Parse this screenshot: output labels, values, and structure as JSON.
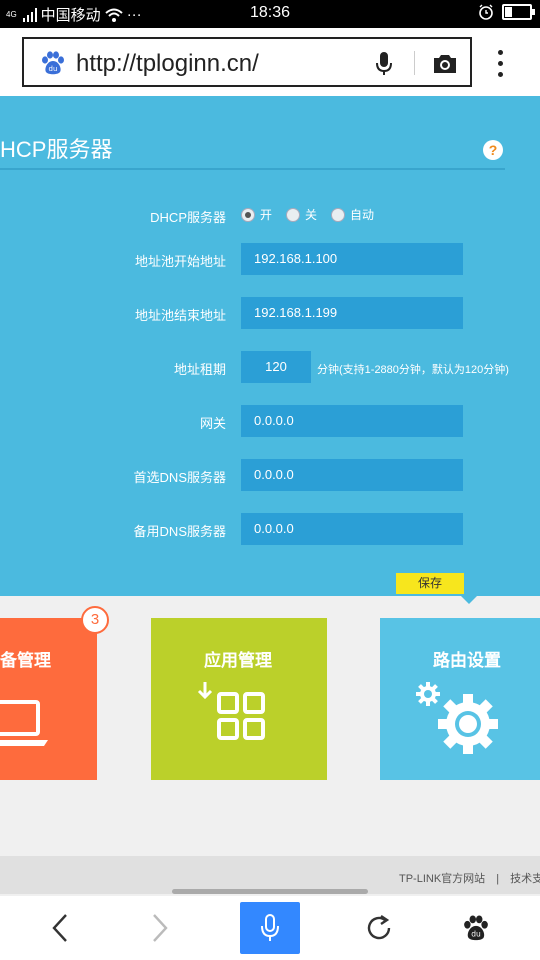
{
  "status_bar": {
    "signal_label": "4G",
    "carrier": "中国移动",
    "dots": "···",
    "time": "18:36",
    "battery_percent": 30
  },
  "browser": {
    "url": "http://tploginn.cn/",
    "icons": [
      "baidu-paw-icon",
      "microphone-icon",
      "camera-icon",
      "more-vertical-icon"
    ]
  },
  "panel": {
    "title": "HCP服务器",
    "help_symbol": "?",
    "dhcp_label": "DHCP服务器",
    "dhcp_options": [
      {
        "label": "开",
        "selected": true
      },
      {
        "label": "关",
        "selected": false
      },
      {
        "label": "自动",
        "selected": false
      }
    ],
    "pool_start_label": "地址池开始地址",
    "pool_start_value": "192.168.1.100",
    "pool_end_label": "地址池结束地址",
    "pool_end_value": "192.168.1.199",
    "lease_label": "地址租期",
    "lease_value": "120",
    "lease_hint": "分钟(支持1-2880分钟，默认为120分钟)",
    "gateway_label": "网关",
    "gateway_value": "0.0.0.0",
    "dns_primary_label": "首选DNS服务器",
    "dns_primary_value": "0.0.0.0",
    "dns_secondary_label": "备用DNS服务器",
    "dns_secondary_value": "0.0.0.0",
    "save_label": "保存"
  },
  "tiles": {
    "device_title": "备管理",
    "device_badge": "3",
    "apps_title": "应用管理",
    "router_title": "路由设置",
    "colors": {
      "device": "#fe6b3d",
      "apps": "#bbd02a",
      "router": "#58c3e5"
    }
  },
  "footer": {
    "official_site": "TP-LINK官方网站",
    "separator": "|",
    "support": "技术支"
  },
  "bottom_nav": [
    "back-icon",
    "forward-icon",
    "voice-icon",
    "refresh-icon",
    "baidu-paw-icon"
  ],
  "colors": {
    "panel_blue": "#4bbadf",
    "field_blue": "#2b9fd6",
    "save_yellow": "#f7e61d",
    "mic_button_blue": "#3388ff"
  }
}
